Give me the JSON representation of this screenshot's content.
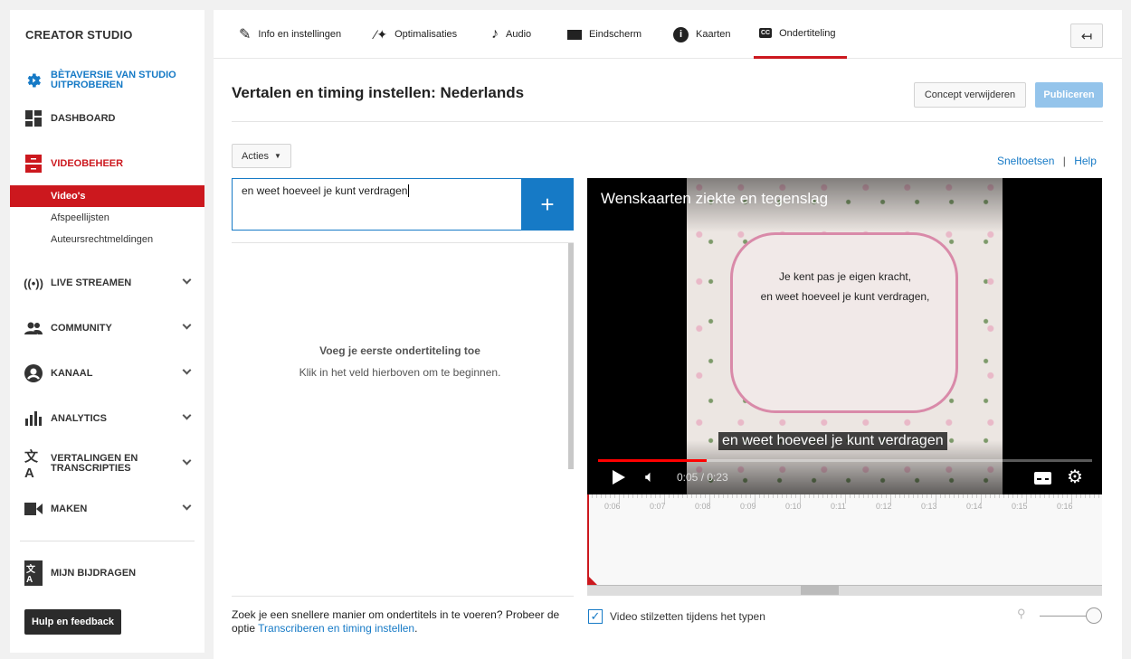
{
  "sidebar": {
    "title": "CREATOR STUDIO",
    "beta": "BÈTAVERSIE VAN STUDIO UITPROBEREN",
    "items": [
      {
        "label": "DASHBOARD",
        "icon": "dashboard-icon"
      },
      {
        "label": "VIDEOBEHEER",
        "icon": "video-manager-icon"
      },
      {
        "label": "LIVE STREAMEN",
        "icon": "live-icon"
      },
      {
        "label": "COMMUNITY",
        "icon": "people-icon"
      },
      {
        "label": "KANAAL",
        "icon": "account-icon"
      },
      {
        "label": "ANALYTICS",
        "icon": "bar-chart-icon"
      },
      {
        "label": "VERTALINGEN EN TRANSCRIPTIES",
        "icon": "translate-icon"
      },
      {
        "label": "MAKEN",
        "icon": "camera-icon"
      }
    ],
    "subitems": [
      "Video's",
      "Afspeellijsten",
      "Auteursrechtmeldingen"
    ],
    "contrib": "MIJN BIJDRAGEN",
    "help": "Hulp en feedback"
  },
  "tabs": [
    "Info en instellingen",
    "Optimalisaties",
    "Audio",
    "Eindscherm",
    "Kaarten",
    "Ondertiteling"
  ],
  "header": {
    "title": "Vertalen en timing instellen: Nederlands",
    "delete": "Concept verwijderen",
    "publish": "Publiceren"
  },
  "actions": "Acties",
  "links": {
    "shortcuts": "Sneltoetsen",
    "sep": "|",
    "help": "Help"
  },
  "input": {
    "value": "en weet hoeveel je kunt verdragen"
  },
  "empty": {
    "title": "Voeg je eerste ondertiteling toe",
    "hint": "Klik in het veld hierboven om te beginnen."
  },
  "footer": {
    "text": "Zoek je een snellere manier om ondertitels in te voeren? Probeer de optie ",
    "link": "Transcriberen en timing instellen",
    "end": "."
  },
  "video": {
    "title": "Wenskaarten ziekte en tegenslag",
    "card_line1": "Je kent pas je eigen kracht,",
    "card_line2": "en weet hoeveel je kunt verdragen,",
    "caption": "en weet hoeveel je kunt verdragen",
    "time": "0:05 / 0:23",
    "progress": 0.22
  },
  "timeline": [
    "0:06",
    "0:07",
    "0:08",
    "0:09",
    "0:10",
    "0:11",
    "0:12",
    "0:13",
    "0:14",
    "0:15",
    "0:16"
  ],
  "pause_checkbox": {
    "label": "Video stilzetten tijdens het typen",
    "checked": true
  },
  "colors": {
    "accent": "#cc181e",
    "blue": "#167ac6",
    "publish": "#94c4eb"
  }
}
